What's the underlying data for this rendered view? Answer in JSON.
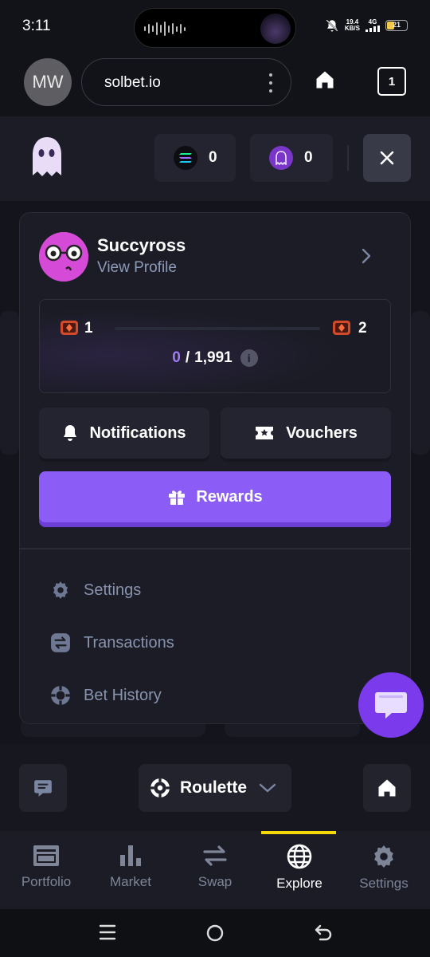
{
  "status_bar": {
    "time": "3:11",
    "net_speed": "19.4",
    "net_unit": "KB/S",
    "network": "4G",
    "battery": "21"
  },
  "browser": {
    "avatar_initials": "MW",
    "url": "solbet.io",
    "tab_count": "1"
  },
  "header": {
    "logo_icon": "ghost-icon",
    "balances": [
      {
        "icon": "solana-icon",
        "amount": "0"
      },
      {
        "icon": "ghost-coin-icon",
        "amount": "0"
      }
    ],
    "close_icon": "close-icon"
  },
  "profile": {
    "username": "Succyross",
    "view_profile": "View Profile",
    "level_current": "1",
    "level_next": "2",
    "xp_current": "0",
    "xp_separator": "/",
    "xp_total": "1,991",
    "xp_progress": 0,
    "info_label": "i",
    "notifications_label": "Notifications",
    "vouchers_label": "Vouchers",
    "rewards_label": "Rewards"
  },
  "menu": [
    {
      "label": "Settings",
      "icon": "gear-icon"
    },
    {
      "label": "Transactions",
      "icon": "swap-icon"
    },
    {
      "label": "Bet History",
      "icon": "chip-icon"
    }
  ],
  "toolbar": {
    "game_label": "Roulette"
  },
  "bottom_nav": [
    {
      "label": "Portfolio",
      "icon": "wallet-icon"
    },
    {
      "label": "Market",
      "icon": "bar-chart-icon"
    },
    {
      "label": "Swap",
      "icon": "swap-arrows-icon"
    },
    {
      "label": "Explore",
      "icon": "globe-icon",
      "active": true
    },
    {
      "label": "Settings",
      "icon": "gear-icon"
    }
  ],
  "colors": {
    "accent": "#8b5cf6",
    "active_indicator": "#f5d90a",
    "background": "#14151c",
    "panel": "#1b1c26"
  }
}
